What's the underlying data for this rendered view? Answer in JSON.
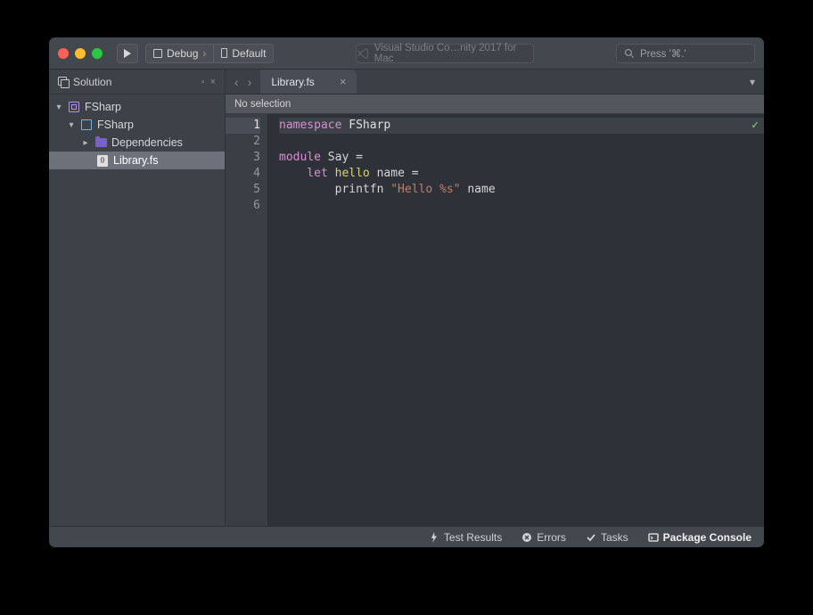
{
  "titlebar": {
    "config_label": "Debug",
    "target_label": "Default",
    "app_title": "Visual Studio Co…nity 2017 for Mac",
    "search_placeholder": "Press '⌘.'"
  },
  "sidebar": {
    "panel_title": "Solution",
    "popout_glyph": "▫",
    "close_glyph": "×",
    "tree": {
      "solution": "FSharp",
      "project": "FSharp",
      "dependencies": "Dependencies",
      "file": "Library.fs"
    }
  },
  "editor": {
    "tab_label": "Library.fs",
    "breadcrumb": "No selection",
    "line_numbers": [
      "1",
      "2",
      "3",
      "4",
      "5",
      "6"
    ],
    "code": {
      "l1_kw": "namespace",
      "l1_ns": " FSharp",
      "l3_kw": "module",
      "l3_rest": " Say =",
      "l4_kw": "    let ",
      "l4_fn": "hello",
      "l4_rest": " name =",
      "l5_head": "        printfn ",
      "l5_str": "\"Hello %s\"",
      "l5_tail": " name"
    }
  },
  "statusbar": {
    "test_results": "Test Results",
    "errors": "Errors",
    "tasks": "Tasks",
    "package_console": "Package Console"
  }
}
